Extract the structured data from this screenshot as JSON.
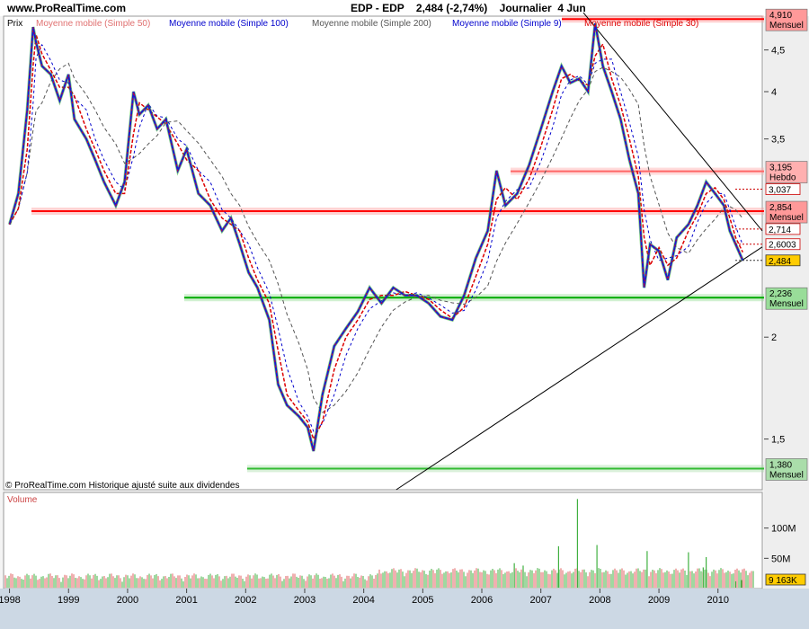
{
  "header": {
    "site": "www.ProRealTime.com",
    "symbol": "EDP - EDP",
    "price": "2,484 (-2,74%)",
    "period": "Journalier  4 Jun"
  },
  "legend": {
    "price_label": "Prix",
    "indicators": [
      {
        "name": "Moyenne mobile (Simple 50)",
        "color": "#e07070"
      },
      {
        "name": "Moyenne mobile (Simple 100)",
        "color": "#0000cc"
      },
      {
        "name": "Moyenne mobile (Simple 200)",
        "color": "#555555"
      },
      {
        "name": "Moyenne mobile (Simple 9)",
        "color": "#0000cc"
      },
      {
        "name": "Moyenne mobile (Simple 30)",
        "color": "#dd0000"
      }
    ]
  },
  "footer_note": "© ProRealTime.com Historique ajusté suite aux dividendes",
  "volume_label": "Volume",
  "chart_data": {
    "type": "line",
    "scale": "log",
    "x_ticks": [
      "1998",
      "1999",
      "2000",
      "2001",
      "2002",
      "2003",
      "2004",
      "2005",
      "2006",
      "2007",
      "2008",
      "2009",
      "2010"
    ],
    "x_range": [
      1997.9,
      2010.75
    ],
    "y_range": [
      1.3,
      4.95
    ],
    "y_ticks": [
      {
        "value": 4.5,
        "label": "4,5"
      },
      {
        "value": 4.0,
        "label": "4"
      },
      {
        "value": 3.5,
        "label": "3,5"
      },
      {
        "value": 2.0,
        "label": "2"
      },
      {
        "value": 1.5,
        "label": "1,5"
      }
    ],
    "price_series": [
      [
        1998.0,
        2.75
      ],
      [
        1998.15,
        3.0
      ],
      [
        1998.3,
        3.8
      ],
      [
        1998.4,
        4.8
      ],
      [
        1998.45,
        4.6
      ],
      [
        1998.55,
        4.3
      ],
      [
        1998.7,
        4.2
      ],
      [
        1998.85,
        3.9
      ],
      [
        1999.0,
        4.2
      ],
      [
        1999.1,
        3.7
      ],
      [
        1999.3,
        3.5
      ],
      [
        1999.45,
        3.3
      ],
      [
        1999.6,
        3.1
      ],
      [
        1999.8,
        2.9
      ],
      [
        1999.95,
        3.1
      ],
      [
        2000.1,
        4.0
      ],
      [
        2000.2,
        3.75
      ],
      [
        2000.35,
        3.85
      ],
      [
        2000.5,
        3.6
      ],
      [
        2000.65,
        3.7
      ],
      [
        2000.85,
        3.2
      ],
      [
        2001.0,
        3.4
      ],
      [
        2001.2,
        3.0
      ],
      [
        2001.4,
        2.9
      ],
      [
        2001.6,
        2.7
      ],
      [
        2001.75,
        2.8
      ],
      [
        2001.9,
        2.6
      ],
      [
        2002.05,
        2.4
      ],
      [
        2002.2,
        2.3
      ],
      [
        2002.4,
        2.1
      ],
      [
        2002.55,
        1.75
      ],
      [
        2002.7,
        1.65
      ],
      [
        2002.9,
        1.6
      ],
      [
        2003.05,
        1.55
      ],
      [
        2003.15,
        1.45
      ],
      [
        2003.3,
        1.7
      ],
      [
        2003.5,
        1.95
      ],
      [
        2003.7,
        2.05
      ],
      [
        2003.9,
        2.15
      ],
      [
        2004.1,
        2.3
      ],
      [
        2004.3,
        2.2
      ],
      [
        2004.5,
        2.3
      ],
      [
        2004.7,
        2.25
      ],
      [
        2004.9,
        2.25
      ],
      [
        2005.1,
        2.2
      ],
      [
        2005.3,
        2.12
      ],
      [
        2005.5,
        2.1
      ],
      [
        2005.7,
        2.25
      ],
      [
        2005.9,
        2.5
      ],
      [
        2006.1,
        2.7
      ],
      [
        2006.25,
        3.2
      ],
      [
        2006.4,
        2.9
      ],
      [
        2006.6,
        3.0
      ],
      [
        2006.8,
        3.25
      ],
      [
        2007.0,
        3.6
      ],
      [
        2007.2,
        4.0
      ],
      [
        2007.35,
        4.3
      ],
      [
        2007.5,
        4.1
      ],
      [
        2007.65,
        4.15
      ],
      [
        2007.8,
        4.0
      ],
      [
        2007.92,
        4.85
      ],
      [
        2008.05,
        4.3
      ],
      [
        2008.2,
        4.0
      ],
      [
        2008.35,
        3.7
      ],
      [
        2008.5,
        3.3
      ],
      [
        2008.65,
        3.0
      ],
      [
        2008.75,
        2.3
      ],
      [
        2008.85,
        2.6
      ],
      [
        2009.0,
        2.55
      ],
      [
        2009.15,
        2.35
      ],
      [
        2009.3,
        2.65
      ],
      [
        2009.5,
        2.75
      ],
      [
        2009.65,
        2.9
      ],
      [
        2009.8,
        3.1
      ],
      [
        2009.95,
        3.0
      ],
      [
        2010.1,
        2.9
      ],
      [
        2010.2,
        2.7
      ],
      [
        2010.3,
        2.6
      ],
      [
        2010.42,
        2.484
      ]
    ],
    "horizontal_levels": [
      {
        "value": 4.91,
        "label": "4,910",
        "tag": "Mensuel",
        "color": "#ff0000",
        "fill": "#ff9999"
      },
      {
        "value": 3.195,
        "label": "3,195",
        "tag": "Hebdo",
        "color": "#ff6666",
        "fill": "#ffb0b0"
      },
      {
        "value": 2.854,
        "label": "2,854",
        "tag": "Mensuel",
        "color": "#ff0000",
        "fill": "#ff9999"
      },
      {
        "value": 2.236,
        "label": "2,236",
        "tag": "Mensuel",
        "color": "#00aa00",
        "fill": "#99dd99"
      },
      {
        "value": 1.38,
        "label": "1,380",
        "tag": "Mensuel",
        "color": "#33bb33",
        "fill": "#aaddaa"
      }
    ],
    "axis_price_tags": [
      {
        "value": 3.037,
        "label": "3,037",
        "border": "#cc0000",
        "fill": "#ffffff"
      },
      {
        "value": 2.714,
        "label": "2,714",
        "border": "#cc0000",
        "fill": "#ffffff"
      },
      {
        "value": 2.6003,
        "label": "2,6003",
        "border": "#cc0000",
        "fill": "#ffffff"
      },
      {
        "value": 2.484,
        "label": "2,484",
        "border": "#333333",
        "fill": "#ffcc00"
      }
    ],
    "trendlines": [
      {
        "from": [
          2007.72,
          5.0
        ],
        "to": [
          2010.75,
          2.7
        ]
      },
      {
        "from": [
          2004.55,
          1.3
        ],
        "to": [
          2010.75,
          2.58
        ]
      }
    ],
    "volume": {
      "unit": "shares",
      "y_range": [
        0,
        150
      ],
      "y_ticks": [
        {
          "value": 100,
          "label": "100M"
        },
        {
          "value": 50,
          "label": "50M"
        }
      ],
      "last_label": "9 163K",
      "spikes": [
        [
          2006.55,
          42
        ],
        [
          2006.7,
          38
        ],
        [
          2007.3,
          70
        ],
        [
          2007.62,
          148
        ],
        [
          2007.95,
          72
        ],
        [
          2008.8,
          62
        ],
        [
          2009.5,
          60
        ],
        [
          2009.75,
          35
        ],
        [
          2009.8,
          52
        ],
        [
          2010.3,
          12
        ],
        [
          2010.4,
          14
        ]
      ]
    }
  }
}
